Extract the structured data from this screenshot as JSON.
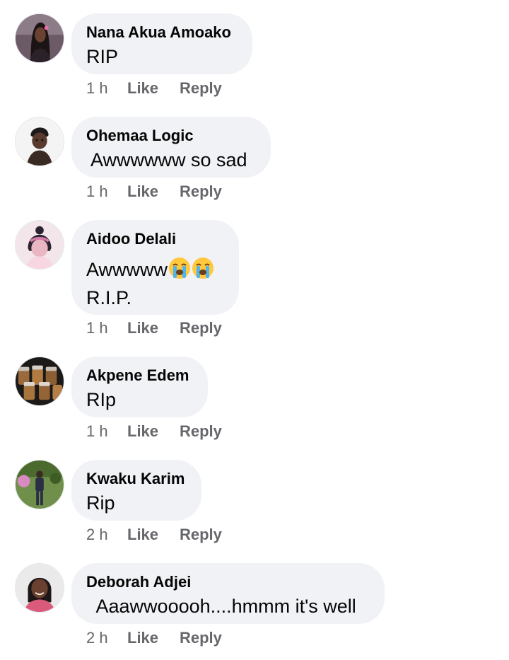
{
  "comments": [
    {
      "author": "Nana Akua Amoako",
      "lines": [
        "RIP"
      ],
      "time": "1 h",
      "like_label": "Like",
      "reply_label": "Reply",
      "avatar": "avatar-woman-dark-hair"
    },
    {
      "author": "Ohemaa Logic",
      "lines": [
        " Awwwwww so sad"
      ],
      "time": "1 h",
      "like_label": "Like",
      "reply_label": "Reply",
      "avatar": "avatar-girl-white-background"
    },
    {
      "author": "Aidoo Delali",
      "lines": [
        "Awwwww",
        "R.I.P."
      ],
      "emoji": "loudly-crying-face",
      "time": "1 h",
      "like_label": "Like",
      "reply_label": "Reply",
      "avatar": "avatar-girl-pink-filter"
    },
    {
      "author": "Akpene Edem",
      "lines": [
        "RIp"
      ],
      "time": "1 h",
      "like_label": "Like",
      "reply_label": "Reply",
      "avatar": "avatar-jars-products"
    },
    {
      "author": "Kwaku Karim",
      "lines": [
        "Rip"
      ],
      "time": "2 h",
      "like_label": "Like",
      "reply_label": "Reply",
      "avatar": "avatar-man-standing-garden"
    },
    {
      "author": "Deborah Adjei",
      "lines": [
        "  Aaawwooooh....hmmm it's well"
      ],
      "time": "2 h",
      "like_label": "Like",
      "reply_label": "Reply",
      "avatar": "avatar-woman-smiling"
    }
  ],
  "colors": {
    "bubble": "#f0f2f5",
    "meta": "#65676b",
    "text": "#050505"
  }
}
